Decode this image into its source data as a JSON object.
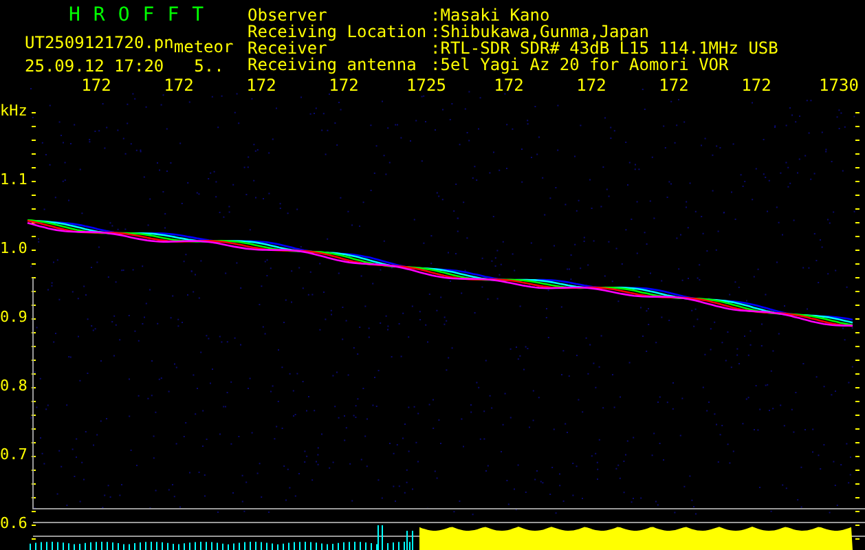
{
  "header": {
    "title": "HROFFT",
    "file_name": "UT2509121720.pn",
    "tag": "meteor",
    "timestamp": "25.09.12 17:20",
    "count": "5.."
  },
  "station_info": [
    {
      "label": "Observer",
      "value": ":Masaki Kano"
    },
    {
      "label": "Receiving Location",
      "value": ":Shibukawa,Gunma,Japan"
    },
    {
      "label": "Receiver",
      "value": ":RTL-SDR SDR# 43dB L15 114.1MHz USB"
    },
    {
      "label": "Receiving antenna",
      "value": ":5el Yagi Az 20 for Aomori VOR"
    }
  ],
  "plot": {
    "y_unit": "kHz",
    "x_ticks": [
      "172",
      "172",
      "172",
      "172",
      "1725",
      "172",
      "172",
      "172",
      "172",
      "1730"
    ],
    "y_ticks": [
      "1.1",
      "1.0",
      "0.9",
      "0.8",
      "0.7",
      "0.6"
    ]
  }
}
